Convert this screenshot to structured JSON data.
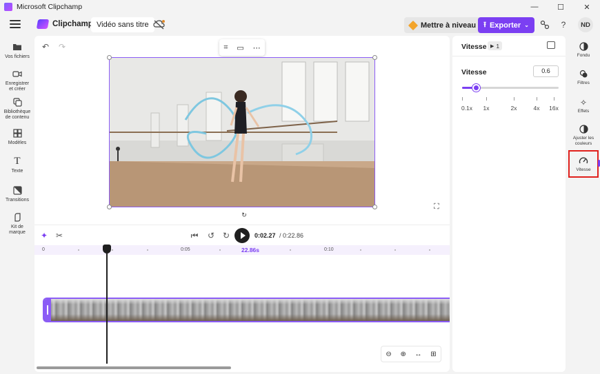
{
  "window": {
    "title": "Microsoft Clipchamp",
    "controls": {
      "minimize": "—",
      "maximize": "☐",
      "close": "✕"
    }
  },
  "header": {
    "brand": "Clipchamp",
    "project_title": "Vidéo sans titre",
    "upgrade_label": "Mettre à niveau",
    "export_label": "Exporter",
    "help_label": "?",
    "avatar_initials": "ND"
  },
  "sidebar": {
    "items": [
      {
        "label": "Vos fichiers",
        "icon": "folder-icon"
      },
      {
        "label": "Enregistrer et créer",
        "icon": "record-icon"
      },
      {
        "label": "Bibliothèque de contenu",
        "icon": "library-icon"
      },
      {
        "label": "Modèles",
        "icon": "templates-icon"
      },
      {
        "label": "Texte",
        "icon": "text-icon"
      },
      {
        "label": "Transitions",
        "icon": "transitions-icon"
      },
      {
        "label": "Kit de marque",
        "icon": "brand-kit-icon"
      }
    ]
  },
  "playback": {
    "current_time": "0:02.27",
    "total_time": "/ 0:22.86"
  },
  "timeline": {
    "ruler_labels": [
      "0",
      "0:05",
      "0:10"
    ],
    "clip_duration": "22.86s"
  },
  "properties": {
    "panel_title": "Vitesse",
    "clip_count": "1",
    "speed_label": "Vitesse",
    "speed_value": "0.6",
    "speed_fraction": 0.14,
    "speed_ticks": [
      "0.1x",
      "1x",
      "2x",
      "4x",
      "16x"
    ]
  },
  "tools_right": {
    "items": [
      {
        "label": "Fondu",
        "icon": "fade-icon"
      },
      {
        "label": "Filtres",
        "icon": "filters-icon"
      },
      {
        "label": "Effets",
        "icon": "effects-icon"
      },
      {
        "label": "Ajuster les couleurs",
        "icon": "adjust-colors-icon"
      },
      {
        "label": "Vitesse",
        "icon": "speed-icon",
        "active": true
      }
    ]
  },
  "colors": {
    "accent": "#7b3ff2",
    "selection_outline": "#e0201c"
  }
}
